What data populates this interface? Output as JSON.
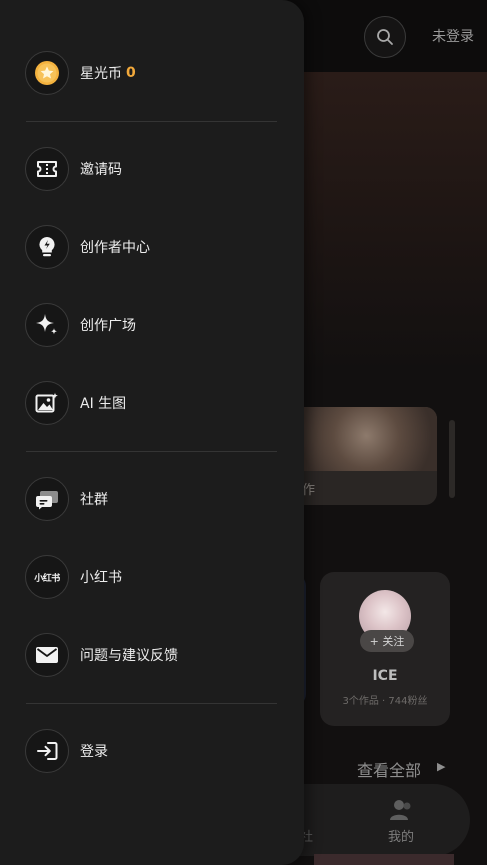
{
  "header": {
    "login_status": "未登录",
    "search_icon": "search-icon"
  },
  "background": {
    "card_caption": "作",
    "creator": {
      "follow_label": "+ 关注",
      "name": "ICE",
      "stats": "3个作品 · 744粉丝"
    },
    "view_all_label": "查看全部",
    "tabbar": {
      "other_tab_fragment": "社",
      "mine_label": "我的"
    }
  },
  "drawer": {
    "coins": {
      "label": "星光币",
      "count": "0",
      "icon": "star-coin-icon",
      "coin_color": "#f2a93b"
    },
    "menu_group_1": [
      {
        "label": "邀请码",
        "icon": "ticket-icon"
      },
      {
        "label": "创作者中心",
        "icon": "lightbulb-icon"
      },
      {
        "label": "创作广场",
        "icon": "sparkle-icon"
      },
      {
        "label": "AI 生图",
        "icon": "ai-image-icon"
      }
    ],
    "menu_group_2": [
      {
        "label": "社群",
        "icon": "chat-bubbles-icon"
      },
      {
        "label": "小红书",
        "icon": "xiaohongshu-icon",
        "icon_text": "小红书"
      },
      {
        "label": "问题与建议反馈",
        "icon": "mail-icon"
      }
    ],
    "login": {
      "label": "登录",
      "icon": "login-icon"
    }
  }
}
